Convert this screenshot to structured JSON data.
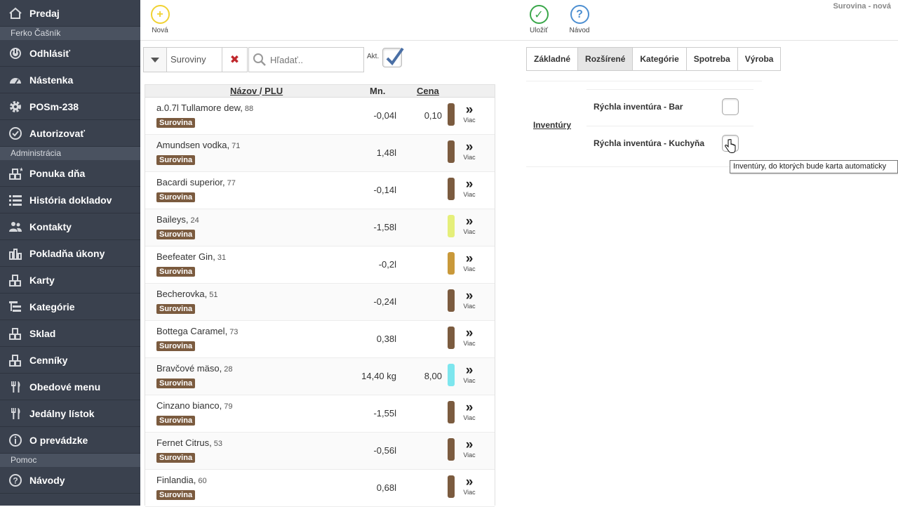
{
  "sidebar": {
    "top": [
      {
        "icon": "home-icon",
        "label": "Predaj"
      }
    ],
    "section_user": "Ferko Čašník",
    "user_items": [
      {
        "icon": "power-icon",
        "label": "Odhlásiť"
      },
      {
        "icon": "dashboard-icon",
        "label": "Nástenka"
      },
      {
        "icon": "gear-icon",
        "label": "POSm-238"
      },
      {
        "icon": "check-circle-icon",
        "label": "Autorizovať"
      }
    ],
    "section_admin": "Administrácia",
    "admin_items": [
      {
        "icon": "boxes-star-icon",
        "label": "Ponuka dňa"
      },
      {
        "icon": "list-icon",
        "label": "História dokladov"
      },
      {
        "icon": "people-icon",
        "label": "Kontakty"
      },
      {
        "icon": "bar-chart-icon",
        "label": "Pokladňa úkony"
      },
      {
        "icon": "boxes-icon",
        "label": "Karty"
      },
      {
        "icon": "tree-icon",
        "label": "Kategórie"
      },
      {
        "icon": "boxes-icon",
        "label": "Sklad"
      },
      {
        "icon": "boxes-icon",
        "label": "Cenníky"
      },
      {
        "icon": "cutlery-icon",
        "label": "Obedové menu"
      },
      {
        "icon": "cutlery-icon",
        "label": "Jedálny lístok"
      },
      {
        "icon": "info-icon",
        "label": "O prevádzke"
      }
    ],
    "section_help": "Pomoc",
    "help_items": [
      {
        "icon": "help-icon",
        "label": "Návody"
      }
    ]
  },
  "toolbar": {
    "new_label": "Nová",
    "save_label": "Uložiť",
    "guide_label": "Návod",
    "page_label": "Surovina - nová"
  },
  "filter": {
    "category": "Suroviny",
    "search_placeholder": "Hľadať..",
    "akt_label": "Akt.",
    "akt_checked": true
  },
  "list": {
    "col_name": "Názov",
    "col_sep": "/",
    "col_plu": "PLU",
    "col_qty": "Mn.",
    "col_price": "Cena",
    "more_label": "Viac",
    "rows": [
      {
        "name": "a.0.7l Tullamore dew",
        "plu": "88",
        "badge": "Surovina",
        "qty": "-0,04l",
        "price": "0,10",
        "color": "#7b5b3f"
      },
      {
        "name": "Amundsen vodka",
        "plu": "71",
        "badge": "Surovina",
        "qty": "1,48l",
        "price": "",
        "color": "#7b5b3f"
      },
      {
        "name": "Bacardi superior",
        "plu": "77",
        "badge": "Surovina",
        "qty": "-0,14l",
        "price": "",
        "color": "#7b5b3f"
      },
      {
        "name": "Baileys",
        "plu": "24",
        "badge": "Surovina",
        "qty": "-1,58l",
        "price": "",
        "color": "#e5ef7a"
      },
      {
        "name": "Beefeater Gin",
        "plu": "31",
        "badge": "Surovina",
        "qty": "-0,2l",
        "price": "",
        "color": "#c9993a"
      },
      {
        "name": "Becherovka",
        "plu": "51",
        "badge": "Surovina",
        "qty": "-0,24l",
        "price": "",
        "color": "#7b5b3f"
      },
      {
        "name": "Bottega Caramel",
        "plu": "73",
        "badge": "Surovina",
        "qty": "0,38l",
        "price": "",
        "color": "#7b5b3f"
      },
      {
        "name": "Bravčové mäso",
        "plu": "28",
        "badge": "Surovina",
        "qty": "14,40 kg",
        "price": "8,00",
        "color": "#7de6ee"
      },
      {
        "name": "Cinzano bianco",
        "plu": "79",
        "badge": "Surovina",
        "qty": "-1,55l",
        "price": "",
        "color": "#7b5b3f"
      },
      {
        "name": "Fernet Citrus",
        "plu": "53",
        "badge": "Surovina",
        "qty": "-0,56l",
        "price": "",
        "color": "#7b5b3f"
      },
      {
        "name": "Finlandia",
        "plu": "60",
        "badge": "Surovina",
        "qty": "0,68l",
        "price": "",
        "color": "#7b5b3f"
      }
    ]
  },
  "tabs": [
    {
      "label": "Základné",
      "active": false
    },
    {
      "label": "Rozšírené",
      "active": true
    },
    {
      "label": "Kategórie",
      "active": false
    },
    {
      "label": "Spotreba",
      "active": false
    },
    {
      "label": "Výroba",
      "active": false
    }
  ],
  "inventory": {
    "label": "Inventúry",
    "items": [
      {
        "label": "Rýchla inventúra - Bar",
        "checked": false
      },
      {
        "label": "Rýchla inventúra - Kuchyňa",
        "checked": false
      }
    ],
    "tooltip": "Inventúry, do ktorých bude karta automaticky"
  }
}
